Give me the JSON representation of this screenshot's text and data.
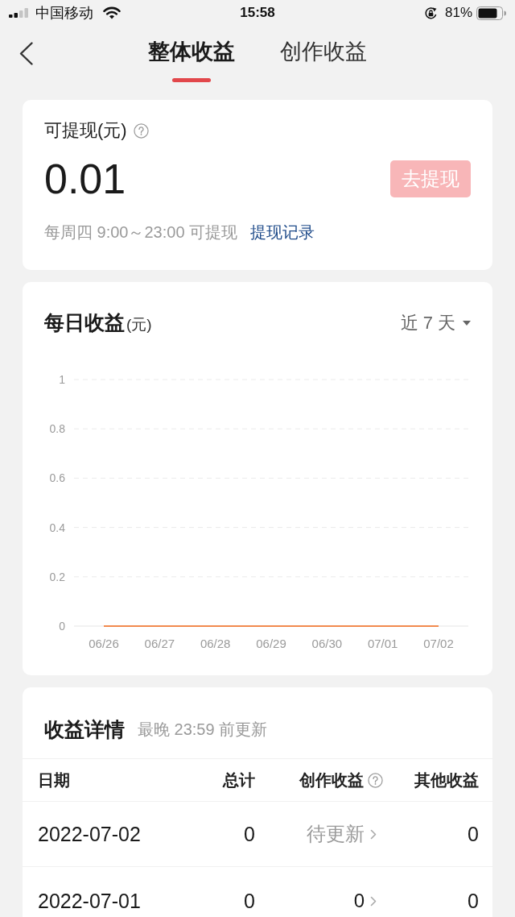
{
  "status_bar": {
    "carrier": "中国移动",
    "time": "15:58",
    "battery": "81%"
  },
  "tabs": [
    {
      "label": "整体收益",
      "selected": true
    },
    {
      "label": "创作收益",
      "selected": false
    }
  ],
  "balance": {
    "label": "可提现(元)",
    "amount": "0.01",
    "button": {
      "label": "去提现",
      "disabled": true
    },
    "schedule": "每周四 9:00～23:00 可提现",
    "link": "提现记录"
  },
  "daily": {
    "title": "每日收益",
    "unit": "(元)",
    "range": "近 7 天",
    "chart_data": {
      "type": "line",
      "categories": [
        "06/26",
        "06/27",
        "06/28",
        "06/29",
        "06/30",
        "07/01",
        "07/02"
      ],
      "series": [
        {
          "color": "#f28a4e",
          "values": [
            0,
            0,
            0,
            0,
            0,
            0,
            0
          ]
        }
      ],
      "ylim": [
        0,
        1
      ],
      "yticks": [
        0,
        0.2,
        0.4,
        0.6,
        0.8,
        1
      ],
      "grid": true
    }
  },
  "details": {
    "title": "收益详情",
    "note": "最晚 23:59 前更新",
    "columns": [
      {
        "label": "日期",
        "kind": "plain"
      },
      {
        "label": "总计",
        "kind": "plain"
      },
      {
        "label": "创作收益",
        "kind": "help"
      },
      {
        "label": "其他收益",
        "kind": "plain"
      }
    ],
    "rows": [
      {
        "date": "2022-07-02",
        "total": "0",
        "creation": {
          "text": "待更新",
          "pending": true
        },
        "other": "0"
      },
      {
        "date": "2022-07-01",
        "total": "0",
        "creation": {
          "text": "0",
          "pending": false
        },
        "other": "0"
      }
    ]
  }
}
